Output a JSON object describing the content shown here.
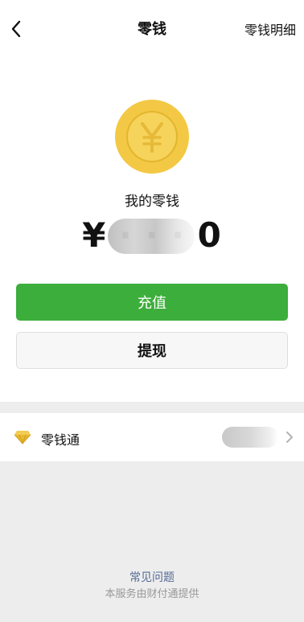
{
  "navbar": {
    "back_icon": "chevron-left-icon",
    "title": "零钱",
    "right_link": "零钱明细"
  },
  "coin": {
    "icon": "yen-coin-icon",
    "symbol": "¥",
    "color": "#f3c844"
  },
  "balance": {
    "label": "我的零钱",
    "amount": "¥  ·  ·  ·  0"
  },
  "actions": {
    "recharge_label": "充值",
    "withdraw_label": "提现",
    "primary_color": "#3cae3b"
  },
  "wallet_row": {
    "icon": "diamond-icon",
    "label": "零钱通",
    "value": "¥          0",
    "chevron_icon": "chevron-right-icon"
  },
  "footer": {
    "faq_link": "常见问题",
    "provider_text": "本服务由财付通提供"
  }
}
